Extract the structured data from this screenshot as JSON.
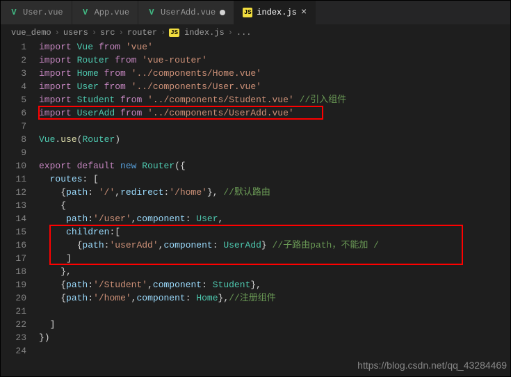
{
  "tabs": [
    {
      "icon": "V",
      "iconClass": "vue-icon",
      "label": "User.vue",
      "active": false,
      "modified": false
    },
    {
      "icon": "V",
      "iconClass": "vue-icon",
      "label": "App.vue",
      "active": false,
      "modified": false
    },
    {
      "icon": "V",
      "iconClass": "vue-icon",
      "label": "UserAdd.vue",
      "active": false,
      "modified": true
    },
    {
      "icon": "JS",
      "iconClass": "js-icon",
      "label": "index.js",
      "active": true,
      "modified": false
    }
  ],
  "breadcrumb": [
    "vue_demo",
    "users",
    "src",
    "router",
    "index.js",
    "..."
  ],
  "breadcrumb_js_icon": "JS",
  "lines": {
    "count": 24
  },
  "code": {
    "l1": {
      "imp": "import",
      "id": "Vue",
      "from": "from",
      "str": "'vue'"
    },
    "l2": {
      "imp": "import",
      "id": "Router",
      "from": "from",
      "str": "'vue-router'"
    },
    "l3": {
      "imp": "import",
      "id": "Home",
      "from": "from",
      "str": "'../components/Home.vue'"
    },
    "l4": {
      "imp": "import",
      "id": "User",
      "from": "from",
      "str": "'../components/User.vue'"
    },
    "l5": {
      "imp": "import",
      "id": "Student",
      "from": "from",
      "str": "'../components/Student.vue'",
      "cmt": " //引入组件"
    },
    "l6": {
      "imp": "import",
      "id": "UserAdd",
      "from": "from",
      "str": "'../components/UserAdd.vue'"
    },
    "l8": {
      "vue": "Vue",
      "use": "use",
      "router": "Router"
    },
    "l10": {
      "exp": "export",
      "def": "default",
      "nw": "new",
      "router": "Router"
    },
    "l11": {
      "routes": "routes"
    },
    "l12": {
      "path": "path",
      "pstr": "'/'",
      "redirect": "redirect",
      "rstr": "'/home'",
      "cmt": " //默认路由"
    },
    "l14": {
      "path": "path",
      "pstr": "'/user'",
      "comp": "component",
      "cname": "User"
    },
    "l15": {
      "children": "children"
    },
    "l16": {
      "path": "path",
      "pstr": "'userAdd'",
      "comp": "component",
      "cname": "UserAdd",
      "cmt": " //子路由path，不能加 /"
    },
    "l19": {
      "path": "path",
      "pstr": "'/Student'",
      "comp": "component",
      "cname": "Student"
    },
    "l20": {
      "path": "path",
      "pstr": "'/home'",
      "comp": "component",
      "cname": "Home",
      "cmt": "//注册组件"
    }
  },
  "watermark": "https://blog.csdn.net/qq_43284469"
}
